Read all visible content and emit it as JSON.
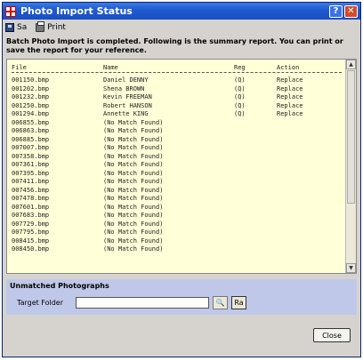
{
  "window": {
    "title": "Photo Import Status"
  },
  "toolbar": {
    "save_label": "Sa",
    "print_label": "Print"
  },
  "message": "Batch Photo Import is completed. Following is the summary report. You can print or save the report for your reference.",
  "report": {
    "headers": {
      "file": "File",
      "name": "Name",
      "reg": "Reg",
      "action": "Action"
    },
    "rows": [
      {
        "file": "001150.bmp",
        "name": "Daniel DENNY",
        "reg": "(Q)",
        "action": "Replace"
      },
      {
        "file": "001202.bmp",
        "name": "Shena BROWN",
        "reg": "(Q)",
        "action": "Replace"
      },
      {
        "file": "001232.bmp",
        "name": "Kevin FREEMAN",
        "reg": "(Q)",
        "action": "Replace"
      },
      {
        "file": "001250.bmp",
        "name": "Robert HANSON",
        "reg": "(Q)",
        "action": "Replace"
      },
      {
        "file": "001294.bmp",
        "name": "Annette KING",
        "reg": "(Q)",
        "action": "Replace"
      },
      {
        "file": "006855.bmp",
        "name": "(No Match Found)",
        "reg": "",
        "action": ""
      },
      {
        "file": "006863.bmp",
        "name": "(No Match Found)",
        "reg": "",
        "action": ""
      },
      {
        "file": "006885.bmp",
        "name": "(No Match Found)",
        "reg": "",
        "action": ""
      },
      {
        "file": "007007.bmp",
        "name": "(No Match Found)",
        "reg": "",
        "action": ""
      },
      {
        "file": "007358.bmp",
        "name": "(No Match Found)",
        "reg": "",
        "action": ""
      },
      {
        "file": "007361.bmp",
        "name": "(No Match Found)",
        "reg": "",
        "action": ""
      },
      {
        "file": "007395.bmp",
        "name": "(No Match Found)",
        "reg": "",
        "action": ""
      },
      {
        "file": "007411.bmp",
        "name": "(No Match Found)",
        "reg": "",
        "action": ""
      },
      {
        "file": "007456.bmp",
        "name": "(No Match Found)",
        "reg": "",
        "action": ""
      },
      {
        "file": "007478.bmp",
        "name": "(No Match Found)",
        "reg": "",
        "action": ""
      },
      {
        "file": "007601.bmp",
        "name": "(No Match Found)",
        "reg": "",
        "action": ""
      },
      {
        "file": "007683.bmp",
        "name": "(No Match Found)",
        "reg": "",
        "action": ""
      },
      {
        "file": "007729.bmp",
        "name": "(No Match Found)",
        "reg": "",
        "action": ""
      },
      {
        "file": "007795.bmp",
        "name": "(No Match Found)",
        "reg": "",
        "action": ""
      },
      {
        "file": "008415.bmp",
        "name": "(No Match Found)",
        "reg": "",
        "action": ""
      },
      {
        "file": "008450.bmp",
        "name": "(No Match Found)",
        "reg": "",
        "action": ""
      }
    ]
  },
  "unmatched": {
    "title": "Unmatched Photographs",
    "target_label": "Target Folder",
    "target_value": "",
    "browse_icon_text": "🔍",
    "open_icon_text": "Ra"
  },
  "footer": {
    "close_label": "Close"
  },
  "colors": {
    "titlebar": "#1f5bd1",
    "report_bg": "#ffffd8",
    "unmatched_bg": "#bfc8e8",
    "dialog_bg": "#d6d3ce"
  }
}
